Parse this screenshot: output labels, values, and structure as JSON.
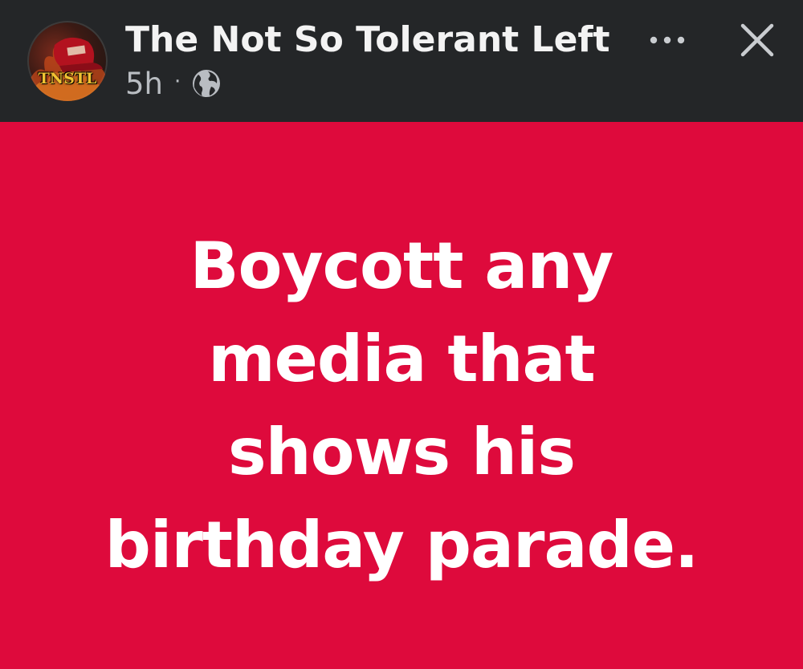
{
  "post": {
    "author": {
      "name": "The Not So Tolerant Left",
      "avatar_text": "TNSTL"
    },
    "timestamp": "5h",
    "separator": "·",
    "audience_icon": "globe-icon",
    "text_lines": [
      "Boycott any",
      "media that",
      "shows his",
      "birthday parade."
    ],
    "background_color": "#de0a3c",
    "text_color": "#ffffff"
  },
  "toolbar": {
    "more_icon": "more-horizontal-icon",
    "close_icon": "close-icon"
  },
  "colors": {
    "header_bg": "#242628",
    "header_text": "#f3f3f3",
    "meta_text": "#b9bdc2"
  }
}
